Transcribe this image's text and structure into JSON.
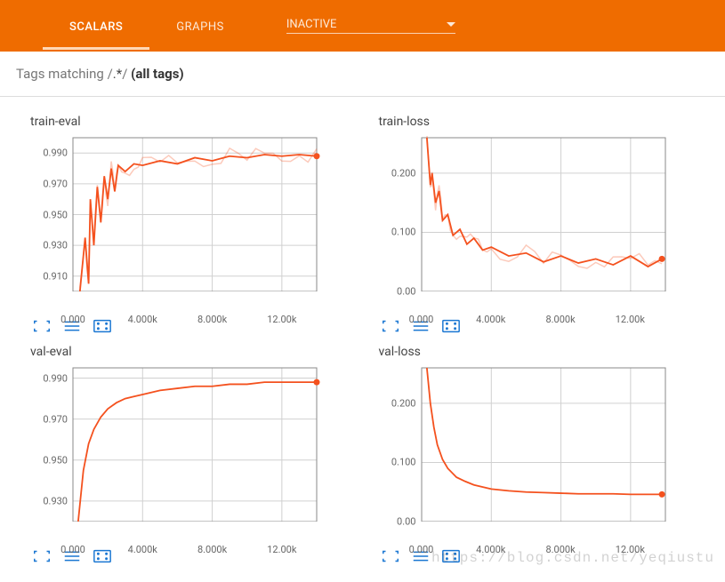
{
  "header": {
    "tabs": [
      {
        "label": "SCALARS",
        "active": true
      },
      {
        "label": "GRAPHS",
        "active": false
      }
    ],
    "inactive_label": "INACTIVE"
  },
  "filter": {
    "prefix": "Tags matching /",
    "regex": ".*",
    "suffix": "/ ",
    "note": "(all tags)"
  },
  "watermark": "https://blog.csdn.net/yeqiustu",
  "colors": {
    "accent": "#ef6c00",
    "line": "#f4511e",
    "grid": "#d0d0d0",
    "axis": "#888"
  },
  "chartkeys": [
    "train_eval",
    "train_loss",
    "val_eval",
    "val_loss"
  ],
  "chart_data": [
    {
      "key": "train_eval",
      "title": "train-eval",
      "type": "line",
      "xlabel": "",
      "ylabel": "",
      "xlim": [
        0,
        14000
      ],
      "ylim": [
        0.9,
        1.0
      ],
      "xticks": [
        {
          "v": 0,
          "t": "0.000"
        },
        {
          "v": 4000,
          "t": "4.000k"
        },
        {
          "v": 8000,
          "t": "8.000k"
        },
        {
          "v": 12000,
          "t": "12.00k"
        }
      ],
      "yticks": [
        {
          "v": 0.91,
          "t": "0.910"
        },
        {
          "v": 0.93,
          "t": "0.930"
        },
        {
          "v": 0.95,
          "t": "0.950"
        },
        {
          "v": 0.97,
          "t": "0.970"
        },
        {
          "v": 0.99,
          "t": "0.990"
        }
      ],
      "series": [
        {
          "name": "train-eval",
          "x": [
            400,
            700,
            900,
            1000,
            1200,
            1400,
            1600,
            1800,
            2000,
            2200,
            2400,
            2600,
            3000,
            3500,
            4000,
            5000,
            6000,
            7000,
            8000,
            9000,
            10000,
            11000,
            12000,
            13000,
            14000
          ],
          "values": [
            0.9,
            0.935,
            0.905,
            0.96,
            0.93,
            0.968,
            0.945,
            0.975,
            0.96,
            0.98,
            0.965,
            0.982,
            0.978,
            0.983,
            0.982,
            0.985,
            0.983,
            0.987,
            0.985,
            0.988,
            0.987,
            0.989,
            0.988,
            0.989,
            0.988
          ]
        }
      ],
      "endpoint": [
        14000,
        0.988
      ],
      "noisy": true
    },
    {
      "key": "train_loss",
      "title": "train-loss",
      "type": "line",
      "xlabel": "",
      "ylabel": "",
      "xlim": [
        0,
        14000
      ],
      "ylim": [
        0.0,
        0.26
      ],
      "xticks": [
        {
          "v": 0,
          "t": "0.000"
        },
        {
          "v": 4000,
          "t": "4.000k"
        },
        {
          "v": 8000,
          "t": "8.000k"
        },
        {
          "v": 12000,
          "t": "12.00k"
        }
      ],
      "yticks": [
        {
          "v": 0.0,
          "t": "0.00"
        },
        {
          "v": 0.1,
          "t": "0.100"
        },
        {
          "v": 0.2,
          "t": "0.200"
        }
      ],
      "series": [
        {
          "name": "train-loss",
          "x": [
            300,
            500,
            600,
            800,
            1000,
            1200,
            1500,
            1800,
            2200,
            2600,
            3000,
            3500,
            4000,
            5000,
            6000,
            7000,
            8000,
            9000,
            10000,
            11000,
            12000,
            13000,
            13800
          ],
          "values": [
            0.26,
            0.18,
            0.2,
            0.15,
            0.17,
            0.12,
            0.13,
            0.095,
            0.105,
            0.08,
            0.09,
            0.07,
            0.075,
            0.06,
            0.065,
            0.05,
            0.06,
            0.048,
            0.055,
            0.045,
            0.06,
            0.042,
            0.055
          ]
        }
      ],
      "endpoint": [
        13800,
        0.055
      ],
      "noisy": true
    },
    {
      "key": "val_eval",
      "title": "val-eval",
      "type": "line",
      "xlabel": "",
      "ylabel": "",
      "xlim": [
        0,
        14000
      ],
      "ylim": [
        0.92,
        0.995
      ],
      "xticks": [
        {
          "v": 0,
          "t": "0.000"
        },
        {
          "v": 4000,
          "t": "4.000k"
        },
        {
          "v": 8000,
          "t": "8.000k"
        },
        {
          "v": 12000,
          "t": "12.00k"
        }
      ],
      "yticks": [
        {
          "v": 0.93,
          "t": "0.930"
        },
        {
          "v": 0.95,
          "t": "0.950"
        },
        {
          "v": 0.97,
          "t": "0.970"
        },
        {
          "v": 0.99,
          "t": "0.990"
        }
      ],
      "series": [
        {
          "name": "val-eval",
          "x": [
            300,
            600,
            900,
            1200,
            1600,
            2000,
            2500,
            3000,
            3500,
            4000,
            5000,
            6000,
            7000,
            8000,
            9000,
            10000,
            11000,
            12000,
            13000,
            14000
          ],
          "values": [
            0.92,
            0.945,
            0.958,
            0.965,
            0.971,
            0.975,
            0.978,
            0.98,
            0.981,
            0.982,
            0.984,
            0.985,
            0.986,
            0.986,
            0.987,
            0.987,
            0.988,
            0.988,
            0.988,
            0.988
          ]
        }
      ],
      "endpoint": [
        14000,
        0.988
      ],
      "noisy": false
    },
    {
      "key": "val_loss",
      "title": "val-loss",
      "type": "line",
      "xlabel": "",
      "ylabel": "",
      "xlim": [
        0,
        14000
      ],
      "ylim": [
        0.0,
        0.26
      ],
      "xticks": [
        {
          "v": 0,
          "t": "0.000"
        },
        {
          "v": 4000,
          "t": "4.000k"
        },
        {
          "v": 8000,
          "t": "8.000k"
        },
        {
          "v": 12000,
          "t": "12.00k"
        }
      ],
      "yticks": [
        {
          "v": 0.0,
          "t": "0.00"
        },
        {
          "v": 0.1,
          "t": "0.100"
        },
        {
          "v": 0.2,
          "t": "0.200"
        }
      ],
      "series": [
        {
          "name": "val-loss",
          "x": [
            300,
            500,
            700,
            900,
            1200,
            1500,
            2000,
            2500,
            3000,
            4000,
            5000,
            6000,
            7000,
            8000,
            9000,
            10000,
            11000,
            12000,
            13000,
            13800
          ],
          "values": [
            0.26,
            0.2,
            0.16,
            0.13,
            0.105,
            0.09,
            0.075,
            0.068,
            0.062,
            0.055,
            0.052,
            0.05,
            0.049,
            0.048,
            0.047,
            0.047,
            0.047,
            0.046,
            0.046,
            0.046
          ]
        }
      ],
      "endpoint": [
        13800,
        0.046
      ],
      "noisy": false
    }
  ]
}
